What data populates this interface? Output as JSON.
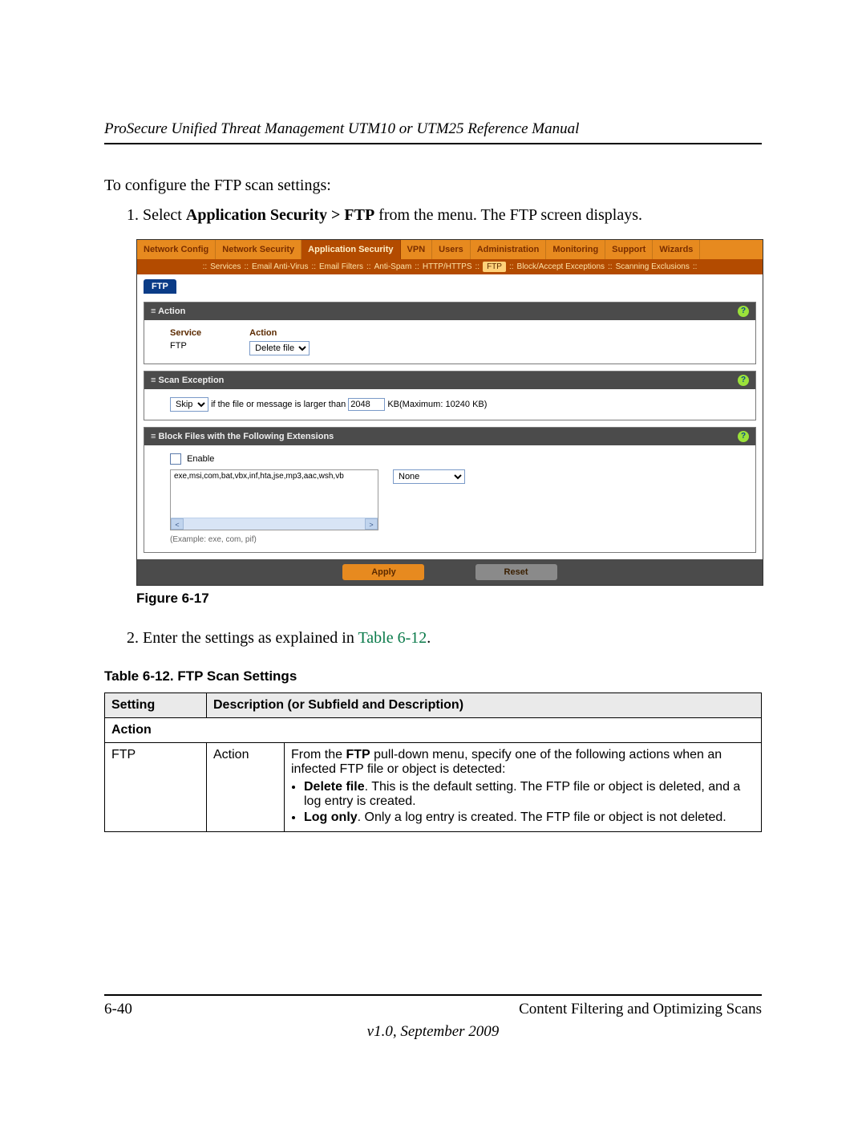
{
  "header": "ProSecure Unified Threat Management UTM10 or UTM25 Reference Manual",
  "intro": "To configure the FTP scan settings:",
  "step1_pre": "Select ",
  "step1_bold": "Application Security > FTP",
  "step1_post": " from the menu. The FTP screen displays.",
  "step2_pre": "Enter the settings as explained in ",
  "step2_link": "Table 6-12",
  "step2_post": ".",
  "figure_caption": "Figure 6-17",
  "table_caption": "Table 6-12. FTP Scan Settings",
  "shot": {
    "topnav": [
      "Network Config",
      "Network Security",
      "Application Security",
      "VPN",
      "Users",
      "Administration",
      "Monitoring",
      "Support",
      "Wizards"
    ],
    "topnav_active": 2,
    "subnav": [
      "Services",
      "Email Anti-Virus",
      "Email Filters",
      "Anti-Spam",
      "HTTP/HTTPS",
      "FTP",
      "Block/Accept Exceptions",
      "Scanning Exclusions"
    ],
    "subnav_sel": 5,
    "crumb": "FTP",
    "action": {
      "title": "Action",
      "service_lbl": "Service",
      "service_val": "FTP",
      "action_lbl": "Action",
      "action_val": "Delete file"
    },
    "scanex": {
      "title": "Scan Exception",
      "skip": "Skip",
      "mid": "if the file or message is larger than",
      "size": "2048",
      "tail": "KB(Maximum: 10240 KB)"
    },
    "block": {
      "title": "Block Files with the Following Extensions",
      "enable": "Enable",
      "ext": "exe,msi,com,bat,vbx,inf,hta,jse,mp3,aac,wsh,vb",
      "none": "None",
      "example": "(Example: exe, com, pif)"
    },
    "apply": "Apply",
    "reset": "Reset"
  },
  "table": {
    "head_setting": "Setting",
    "head_desc": "Description (or Subfield and Description)",
    "section": "Action",
    "r1c1": "FTP",
    "r1c2": "Action",
    "r1c3_pre": "From the ",
    "r1c3_b1": "FTP",
    "r1c3_mid": " pull-down menu, specify one of the following actions when an infected FTP file or object is detected:",
    "r1c3_li1_b": "Delete file",
    "r1c3_li1": ". This is the default setting. The FTP file or object is deleted, and a log entry is created.",
    "r1c3_li2_b": "Log only",
    "r1c3_li2": ". Only a log entry is created. The FTP file or object is not deleted."
  },
  "footer": {
    "left": "6-40",
    "right": "Content Filtering and Optimizing Scans",
    "version": "v1.0, September 2009"
  }
}
